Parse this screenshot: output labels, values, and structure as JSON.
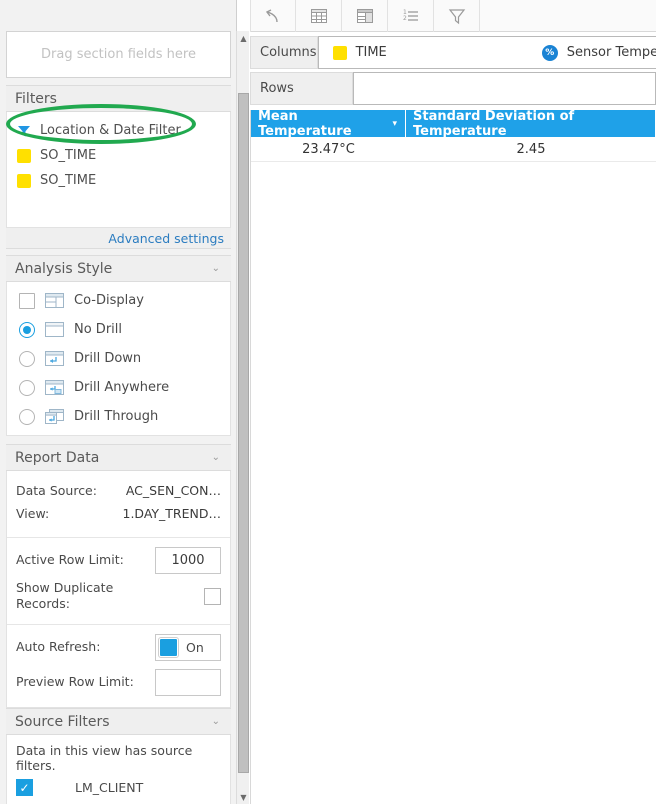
{
  "left_panel": {
    "drag_zone": {
      "placeholder": "Drag section fields here"
    },
    "filters": {
      "title": "Filters",
      "items": [
        {
          "label": "Location & Date Filter",
          "icon": "funnel-icon"
        },
        {
          "label": "SO_TIME",
          "icon": "yellow-square-icon"
        },
        {
          "label": "SO_TIME",
          "icon": "yellow-square-icon"
        }
      ],
      "advanced_settings": "Advanced settings"
    },
    "analysis_style": {
      "title": "Analysis Style",
      "chevron": "⌄",
      "options": [
        {
          "label": "Co-Display",
          "control": "checkbox",
          "selected": false,
          "icon": "co-display-icon"
        },
        {
          "label": "No Drill",
          "control": "radio",
          "selected": true,
          "icon": "no-drill-icon"
        },
        {
          "label": "Drill Down",
          "control": "radio",
          "selected": false,
          "icon": "drill-down-icon"
        },
        {
          "label": "Drill Anywhere",
          "control": "radio",
          "selected": false,
          "icon": "drill-anywhere-icon"
        },
        {
          "label": "Drill Through",
          "control": "radio",
          "selected": false,
          "icon": "drill-through-icon"
        }
      ]
    },
    "report_data": {
      "title": "Report Data",
      "chevron": "⌄",
      "data_source_label": "Data Source:",
      "data_source_value": "AC_SEN_CON…",
      "view_label": "View:",
      "view_value": "1.DAY_TREND…",
      "active_row_limit_label": "Active Row Limit:",
      "active_row_limit_value": "1000",
      "show_duplicate_label": "Show Duplicate Records:",
      "show_duplicate_checked": false,
      "auto_refresh_label": "Auto Refresh:",
      "auto_refresh_state": "On",
      "preview_row_limit_label": "Preview Row Limit:",
      "preview_row_limit_value": ""
    },
    "source_filters": {
      "title": "Source Filters",
      "chevron": "⌄",
      "note": "Data in this view has source filters.",
      "item_label": "LM_CLIENT",
      "item_checked": true,
      "check_glyph": "✓"
    },
    "scrollbar": {
      "up_glyph": "▲",
      "down_glyph": "▼"
    }
  },
  "toolbar": {
    "buttons": [
      {
        "name": "undo-icon",
        "title": "Undo"
      },
      {
        "name": "table-icon",
        "title": "Table"
      },
      {
        "name": "report-layout-icon",
        "title": "Layout"
      },
      {
        "name": "list-icon",
        "title": "List"
      },
      {
        "name": "filter-icon",
        "title": "Filter"
      }
    ]
  },
  "shelves": {
    "columns_label": "Columns",
    "columns_chips": [
      {
        "label": "TIME",
        "icon": "yellow-square-icon"
      },
      {
        "label": "Sensor Temperatu",
        "icon": "percent-icon"
      }
    ],
    "rows_label": "Rows",
    "rows_chips": []
  },
  "grid": {
    "headers": [
      {
        "label": "Mean Temperature",
        "sorted": true,
        "sort_glyph": "▾"
      },
      {
        "label": "Standard Deviation of Temperature",
        "sorted": false,
        "sort_glyph": ""
      }
    ],
    "rows": [
      [
        "23.47°C",
        "2.45"
      ]
    ]
  },
  "colors": {
    "grid_header_blue": "#1fa1e8",
    "annotation_green": "#21a94f",
    "accent_blue": "#1a9fe0",
    "chip_yellow": "#ffe000",
    "link_blue": "#2b7cc0"
  }
}
